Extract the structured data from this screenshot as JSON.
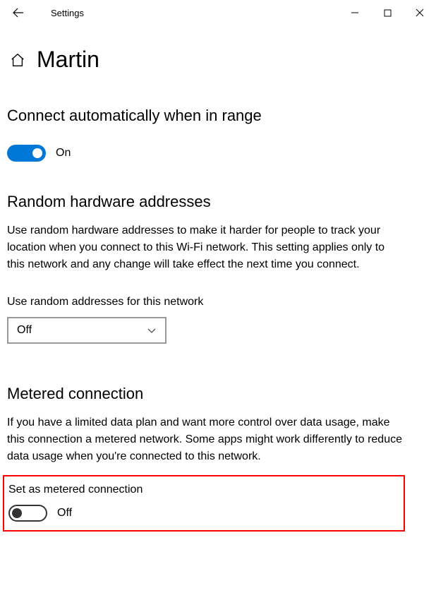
{
  "window": {
    "title": "Settings"
  },
  "page": {
    "title": "Martin"
  },
  "sections": {
    "autoConnect": {
      "heading": "Connect automatically when in range",
      "toggleState": "On"
    },
    "randomHw": {
      "heading": "Random hardware addresses",
      "description": "Use random hardware addresses to make it harder for people to track your location when you connect to this Wi-Fi network. This setting applies only to this network and any change will take effect the next time you connect.",
      "dropdownLabel": "Use random addresses for this network",
      "dropdownValue": "Off"
    },
    "metered": {
      "heading": "Metered connection",
      "description": "If you have a limited data plan and want more control over data usage, make this connection a metered network. Some apps might work differently to reduce data usage when you're connected to this network.",
      "toggleLabel": "Set as metered connection",
      "toggleState": "Off"
    }
  }
}
